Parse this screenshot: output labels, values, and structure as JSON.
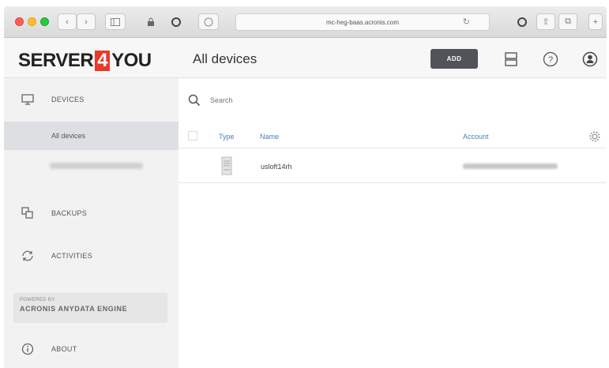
{
  "browser": {
    "url": "mc-heg-baas.acronis.com",
    "reload_icon": "reload-icon",
    "back_icon": "chevron-left-icon",
    "forward_icon": "chevron-right-icon"
  },
  "brand": {
    "logo_left": "SERVER",
    "logo_number": "4",
    "logo_right": "YOU",
    "accent_color": "#e8392a"
  },
  "sidebar": {
    "devices_label": "DEVICES",
    "sub_items": [
      {
        "label": "All devices",
        "active": true
      },
      {
        "label": "",
        "blurred": true
      }
    ],
    "backups_label": "BACKUPS",
    "activities_label": "ACTIVITIES",
    "powered_by_small": "POWERED BY",
    "powered_by_big": "ACRONIS ANYDATA ENGINE",
    "about_label": "ABOUT"
  },
  "header": {
    "title": "All devices",
    "add_label": "ADD"
  },
  "search": {
    "placeholder": "Search"
  },
  "table": {
    "columns": {
      "type": "Type",
      "name": "Name",
      "account": "Account"
    },
    "rows": [
      {
        "type_icon": "server-icon",
        "name": "usloft14rh",
        "account_blurred": true
      }
    ]
  }
}
